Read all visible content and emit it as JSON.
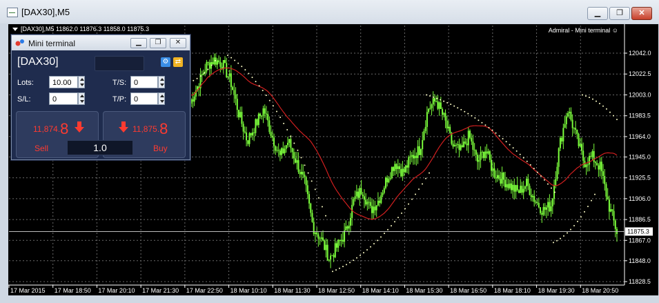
{
  "window": {
    "title": "[DAX30],M5",
    "min_label": "▁",
    "max_label": "❐",
    "close_label": "✕"
  },
  "chart": {
    "header_label": "[DAX30],M5  11862.0 11876.3 11858.0 11875.3",
    "top_right_label": "Admiral - Mini terminal ☺",
    "current_price_label": "11875.3",
    "price_axis": [
      "12042.0",
      "12022.5",
      "12003.0",
      "11983.5",
      "11964.0",
      "11945.0",
      "11925.5",
      "11906.0",
      "11886.5",
      "11867.0",
      "11848.0",
      "11828.5"
    ],
    "time_axis": [
      "17 Mar 2015",
      "17 Mar 18:50",
      "17 Mar 20:10",
      "17 Mar 21:30",
      "17 Mar 22:50",
      "18 Mar 10:10",
      "18 Mar 11:30",
      "18 Mar 12:50",
      "18 Mar 14:10",
      "18 Mar 15:30",
      "18 Mar 16:50",
      "18 Mar 18:10",
      "18 Mar 19:30",
      "18 Mar 20:50"
    ],
    "colors": {
      "bg": "#000000",
      "candle": "#7cff3c",
      "ma": "#d11f1f",
      "sar": "#ffffc8",
      "grid": "#6a6a6a"
    }
  },
  "mini_terminal": {
    "title": "Mini terminal",
    "symbol": "[DAX30]",
    "lots_label": "Lots:",
    "lots_value": "10.00",
    "ts_label": "T/S:",
    "ts_value": "0",
    "sl_label": "S/L:",
    "sl_value": "0",
    "tp_label": "T/P:",
    "tp_value": "0",
    "sell_price_main": "11,874.",
    "sell_price_big": "8",
    "buy_price_main": "11,875.",
    "buy_price_big": "8",
    "sell_label": "Sell",
    "buy_label": "Buy",
    "quantity": "1.0",
    "icons": [
      "gear-icon",
      "swap-icon"
    ]
  },
  "chart_data": {
    "type": "candlestick",
    "series": [
      {
        "name": "price",
        "values": [
          11995,
          12012,
          12030,
          12036,
          12032,
          12015,
          11985,
          11960,
          11975,
          11990,
          11965,
          11945,
          11960,
          11940,
          11920,
          11880,
          11868,
          11850,
          11862,
          11875,
          11905,
          11915,
          11895,
          11905,
          11925,
          11940,
          11930,
          11945,
          11952,
          11990,
          11998,
          11980,
          11955,
          11950,
          11965,
          11940,
          11952,
          11930,
          11925,
          11918,
          11912,
          11920,
          11905,
          11895,
          11900,
          11955,
          11990,
          11965,
          11940,
          11945,
          11935,
          11900,
          11875
        ]
      }
    ],
    "ylim": [
      11828.5,
      12042.0
    ],
    "grid": true
  }
}
